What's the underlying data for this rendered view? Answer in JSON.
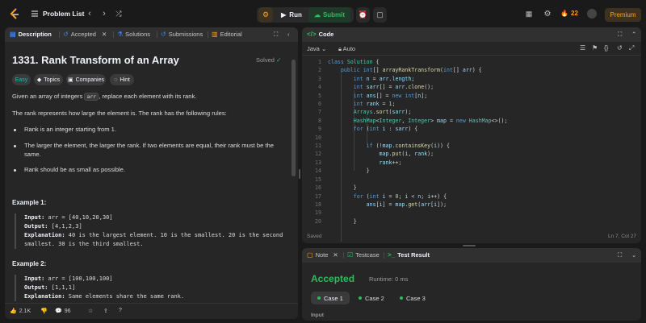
{
  "topbar": {
    "problem_list": "Problem List",
    "run": "Run",
    "submit": "Submit",
    "streak": "22",
    "premium": "Premium"
  },
  "desc_tabs": {
    "description": "Description",
    "accepted": "Accepted",
    "solutions": "Solutions",
    "submissions": "Submissions",
    "editorial": "Editorial"
  },
  "problem": {
    "title": "1331. Rank Transform of an Array",
    "status": "Solved",
    "tags": {
      "difficulty": "Easy",
      "topics": "Topics",
      "companies": "Companies",
      "hint": "Hint"
    },
    "intro_a": "Given an array of integers ",
    "intro_code": "arr",
    "intro_b": ", replace each element with its rank.",
    "rules_intro": "The rank represents how large the element is. The rank has the following rules:",
    "rules": [
      "Rank is an integer starting from 1.",
      "The larger the element, the larger the rank. If two elements are equal, their rank must be the same.",
      "Rank should be as small as possible."
    ],
    "example1": {
      "title": "Example 1:",
      "input_label": "Input:",
      "input": " arr = [40,10,20,30]",
      "output_label": "Output:",
      "output": " [4,1,2,3]",
      "expl_label": "Explanation:",
      "expl": " 40 is the largest element. 10 is the smallest. 20 is the second smallest. 30 is the third smallest."
    },
    "example2": {
      "title": "Example 2:",
      "input_label": "Input:",
      "input": " arr = [100,100,100]",
      "output_label": "Output:",
      "output": " [1,1,1]",
      "expl_label": "Explanation:",
      "expl": " Same elements share the same rank."
    }
  },
  "desc_footer": {
    "likes": "2.1K",
    "comments": "96"
  },
  "code": {
    "header": "Code",
    "language": "Java",
    "mode": "Auto",
    "saved": "Saved",
    "cursor": "Ln 7, Col 27",
    "line_numbers": [
      "1",
      "2",
      "3",
      "4",
      "5",
      "6",
      "7",
      "8",
      "9",
      "10",
      "11",
      "12",
      "13",
      "14",
      "15",
      "16",
      "17",
      "18",
      "19",
      "20"
    ]
  },
  "result": {
    "tab_note": "Note",
    "tab_testcase": "Testcase",
    "tab_result": "Test Result",
    "status": "Accepted",
    "runtime": "Runtime: 0 ms",
    "cases": [
      "Case 1",
      "Case 2",
      "Case 3"
    ],
    "input_label": "Input"
  },
  "colors": {
    "accent": "#ffa116",
    "success": "#2cbb5d",
    "easy": "#1cb8b8"
  }
}
